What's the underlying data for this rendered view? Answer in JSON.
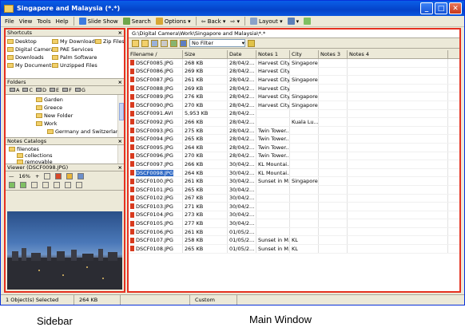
{
  "window": {
    "title": "Singapore and Malaysia (*.*)",
    "minimize": "_",
    "maximize": "□",
    "close": "✕"
  },
  "menu": [
    "File",
    "View",
    "Tools",
    "Help"
  ],
  "toolbar": {
    "slideshow": "Slide Show",
    "search": "Search",
    "options": "Options",
    "back": "Back",
    "layout": "Layout"
  },
  "shortcuts": {
    "title": "Shortcuts",
    "items": [
      "Desktop",
      "My Downloads",
      "Zip Files",
      "Digital Camera",
      "PAE Services",
      "Downloads",
      "Palm Software",
      "My Documents",
      "Unzipped Files"
    ]
  },
  "folders": {
    "title": "Folders",
    "drives": [
      "A",
      "C",
      "D",
      "E",
      "F",
      "G"
    ],
    "tree": [
      "Garden",
      "Greece",
      "New Folder",
      "Work",
      "Germany and Switzerland"
    ]
  },
  "notes_catalogs": {
    "title": "Notes Catalogs",
    "items": [
      "filenotes",
      "collections",
      "removable"
    ]
  },
  "viewer": {
    "title": "Viewer (DSCF0098.JPG)",
    "zoom": "16%"
  },
  "main": {
    "path": "G:\\Digital Camera\\Work\\Singapore and Malaysia\\*.*",
    "filter": "No Filter",
    "columns": [
      "Filename /",
      "Size",
      "Date",
      "Notes 1",
      "City",
      "Notes 3",
      "Notes 4"
    ],
    "rows": [
      [
        "DSCF0085.JPG",
        "268 KB",
        "28/04/2...",
        "Harvest City...",
        "Singapore"
      ],
      [
        "DSCF0086.JPG",
        "269 KB",
        "28/04/2...",
        "Harvest City...",
        ""
      ],
      [
        "DSCF0087.JPG",
        "261 KB",
        "28/04/2...",
        "Harvest City...",
        "Singapore"
      ],
      [
        "DSCF0088.JPG",
        "269 KB",
        "28/04/2...",
        "Harvest City...",
        ""
      ],
      [
        "DSCF0089.JPG",
        "276 KB",
        "28/04/2...",
        "Harvest City...",
        "Singapore"
      ],
      [
        "DSCF0090.JPG",
        "270 KB",
        "28/04/2...",
        "Harvest City...",
        "Singapore"
      ],
      [
        "DSCF0091.AVI",
        "5,953 KB",
        "28/04/2...",
        "",
        ""
      ],
      [
        "DSCF0092.JPG",
        "266 KB",
        "28/04/2...",
        "",
        "Kuala Lu..."
      ],
      [
        "DSCF0093.JPG",
        "275 KB",
        "28/04/2...",
        "Twin Tower...",
        ""
      ],
      [
        "DSCF0094.JPG",
        "265 KB",
        "28/04/2...",
        "Twin Tower...",
        ""
      ],
      [
        "DSCF0095.JPG",
        "264 KB",
        "28/04/2...",
        "Twin Tower...",
        ""
      ],
      [
        "DSCF0096.JPG",
        "270 KB",
        "28/04/2...",
        "Twin Tower...",
        ""
      ],
      [
        "DSCF0097.JPG",
        "266 KB",
        "30/04/2...",
        "KL Mountai...",
        ""
      ],
      [
        "DSCF0098.JPG",
        "264 KB",
        "30/04/2...",
        "KL Mountai...",
        ""
      ],
      [
        "DSCF0100.JPG",
        "261 KB",
        "30/04/2...",
        "Sunset in M...",
        "Singapore"
      ],
      [
        "DSCF0101.JPG",
        "265 KB",
        "30/04/2...",
        "",
        ""
      ],
      [
        "DSCF0102.JPG",
        "267 KB",
        "30/04/2...",
        "",
        ""
      ],
      [
        "DSCF0103.JPG",
        "271 KB",
        "30/04/2...",
        "",
        ""
      ],
      [
        "DSCF0104.JPG",
        "273 KB",
        "30/04/2...",
        "",
        ""
      ],
      [
        "DSCF0105.JPG",
        "277 KB",
        "30/04/2...",
        "",
        ""
      ],
      [
        "DSCF0106.JPG",
        "261 KB",
        "01/05/2...",
        "",
        ""
      ],
      [
        "DSCF0107.JPG",
        "258 KB",
        "01/05/2...",
        "Sunset in M...",
        "KL"
      ],
      [
        "DSCF0108.JPG",
        "265 KB",
        "01/05/2...",
        "Sunset in M...",
        "KL"
      ]
    ],
    "selected_index": 13
  },
  "status": {
    "selected": "1 Object(s) Selected",
    "size": "264 KB",
    "mode": "Custom"
  },
  "captions": {
    "sidebar": "Sidebar",
    "main": "Main Window"
  },
  "colors": {
    "highlight": "#e53120",
    "title": "#0443c9",
    "selection": "#316ac5"
  }
}
